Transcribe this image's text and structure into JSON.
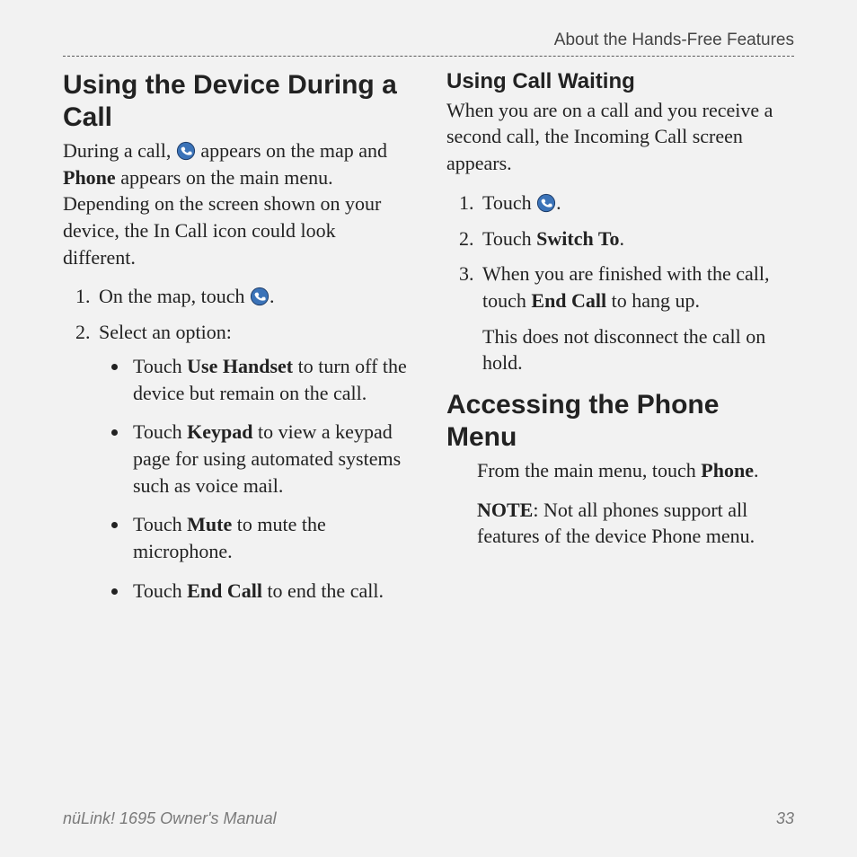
{
  "header": {
    "section": "About the Hands-Free Features"
  },
  "left": {
    "h2": "Using the Device During a Call",
    "intro_parts": {
      "a": "During a call, ",
      "b": " appears on the map and ",
      "c": "Phone",
      "d": " appears on the main menu. Depending on the screen shown on your device, the In Call icon could look different."
    },
    "step1_pre": "On the map, touch ",
    "step1_post": ".",
    "step2": "Select an option:",
    "bullets": [
      {
        "pre": "Touch ",
        "bold": "Use Handset",
        "post": " to turn off the device but remain on the call."
      },
      {
        "pre": "Touch ",
        "bold": "Keypad",
        "post": " to view a keypad page for using automated systems such as voice mail."
      },
      {
        "pre": "Touch ",
        "bold": "Mute",
        "post": " to mute the microphone."
      },
      {
        "pre": "Touch ",
        "bold": "End Call",
        "post": " to end the call."
      }
    ]
  },
  "right": {
    "h3": "Using Call Waiting",
    "intro": "When you are on a call and you receive a second call, the Incoming Call screen appears.",
    "steps": {
      "s1_pre": "Touch ",
      "s1_post": ".",
      "s2_pre": "Touch ",
      "s2_bold": "Switch To",
      "s2_post": ".",
      "s3_pre": "When you are finished with the call, touch ",
      "s3_bold": "End Call",
      "s3_post": " to hang up.",
      "s3_trail": "This does not disconnect the call on hold."
    },
    "h2": "Accessing the Phone Menu",
    "access": {
      "p1_pre": "From the main menu, touch ",
      "p1_bold": "Phone",
      "p1_post": ".",
      "p2_bold": "NOTE",
      "p2_post": ": Not all phones support all features of the device Phone menu."
    }
  },
  "footer": {
    "title": "nüLink! 1695 Owner's Manual",
    "page": "33"
  }
}
